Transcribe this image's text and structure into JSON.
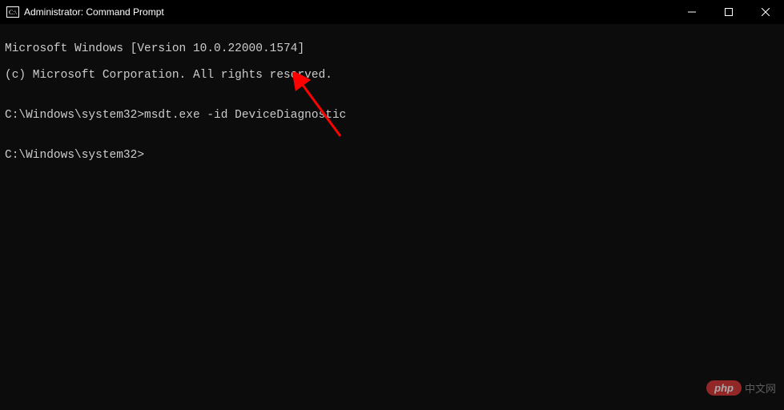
{
  "window": {
    "title": "Administrator: Command Prompt"
  },
  "terminal": {
    "line1": "Microsoft Windows [Version 10.0.22000.1574]",
    "line2": "(c) Microsoft Corporation. All rights reserved.",
    "blank1": "",
    "prompt1_path": "C:\\Windows\\system32>",
    "prompt1_command": "msdt.exe -id DeviceDiagnostic",
    "blank2": "",
    "prompt2_path": "C:\\Windows\\system32>",
    "prompt2_command": ""
  },
  "watermark": {
    "badge": "php",
    "text": "中文网"
  }
}
